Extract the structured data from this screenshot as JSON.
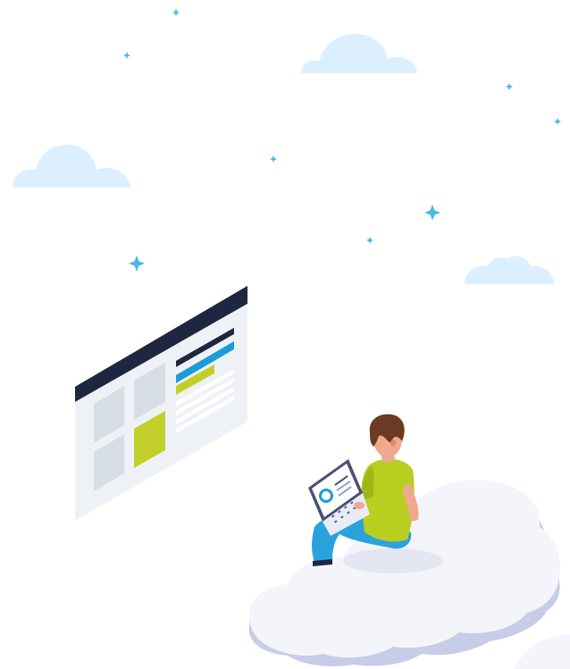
{
  "colors": {
    "background": "#ffffff",
    "sky_cloud": "#dcefff",
    "sparkle": "#4ab8e8",
    "panel_face": "#eef2f6",
    "panel_header": "#1f2640",
    "panel_tile": "#d7dde5",
    "accent_lime": "#c2cf2a",
    "accent_blue": "#1e9bd7",
    "cloud_top": "#f4f5fa",
    "cloud_side": "#c7cde8",
    "shirt": "#b8cf1f",
    "pants": "#2aa3dc",
    "skin": "#f0a98f",
    "hair": "#6b3a22",
    "laptop_frame": "#4a4f73"
  },
  "icons": [
    "cloud-icon",
    "sparkle-icon",
    "web-page-illustration",
    "person-with-laptop-illustration"
  ]
}
